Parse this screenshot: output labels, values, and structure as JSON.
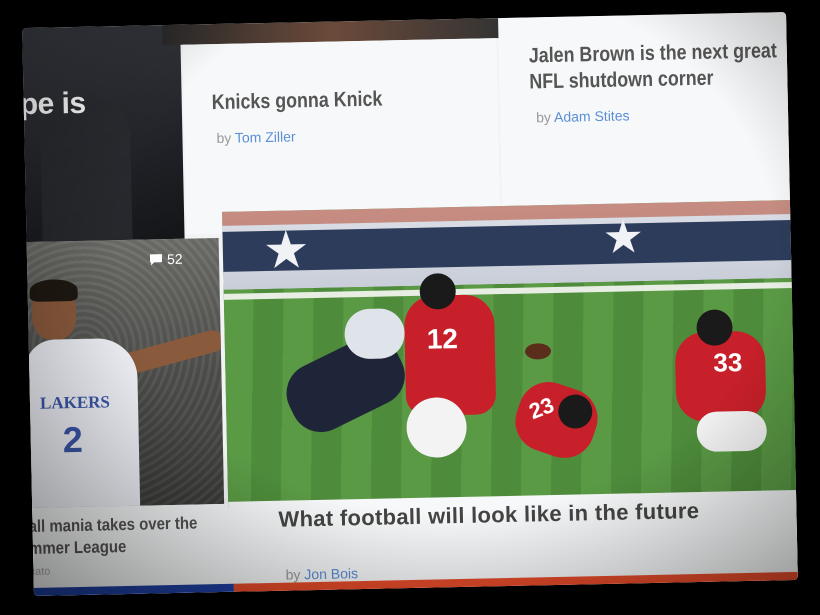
{
  "tiles": {
    "top_left": {
      "headline_fragment": "pe is"
    },
    "knicks": {
      "title": "Knicks gonna Knick",
      "by": "by",
      "author": "Tom Ziller"
    },
    "jalen": {
      "title": "Jalen Brown is the next great NFL shutdown corner",
      "by": "by",
      "author": "Adam Stites"
    },
    "lonzo": {
      "comment_count": "52",
      "jersey_text": "LAKERS",
      "jersey_number": "2",
      "title": "all mania takes over the mmer League",
      "author_fragment": "cato"
    },
    "football": {
      "title": "What football will look like in the future",
      "by": "by",
      "author": "Jon Bois",
      "jersey_numbers": [
        "12",
        "33",
        "23"
      ]
    }
  },
  "colors": {
    "link_blue": "#5a8fd8",
    "accent_red": "#e54b2a",
    "accent_blue": "#1e3fa0",
    "falcons_red": "#c8202a"
  }
}
